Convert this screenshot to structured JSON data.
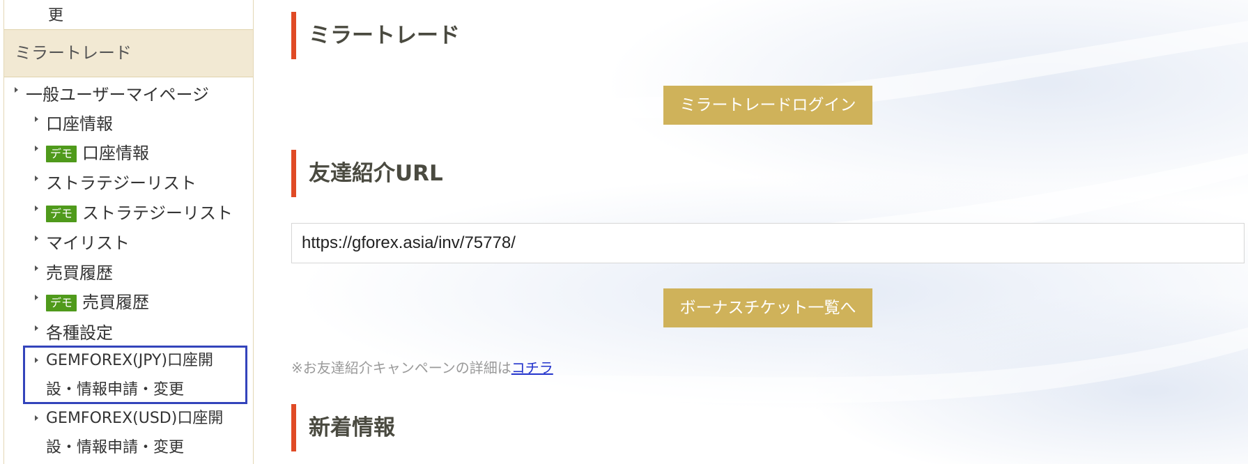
{
  "sidebar": {
    "prev_item_fragment": "更",
    "section_header": "ミラートレード",
    "items": [
      {
        "label": "一般ユーザーマイページ",
        "demo": false
      },
      {
        "label": "口座情報",
        "demo": false
      },
      {
        "label": "口座情報",
        "demo": true
      },
      {
        "label": "ストラテジーリスト",
        "demo": false
      },
      {
        "label": "ストラテジーリスト",
        "demo": true
      },
      {
        "label": "マイリスト",
        "demo": false
      },
      {
        "label": "売買履歴",
        "demo": false
      },
      {
        "label": "売買履歴",
        "demo": true
      },
      {
        "label": "各種設定",
        "demo": false
      },
      {
        "label_line1": "GEMFOREX(JPY)口座開",
        "label_line2": "設・情報申請・変更",
        "highlighted": true
      },
      {
        "label_line1": "GEMFOREX(USD)口座開",
        "label_line2": "設・情報申請・変更"
      }
    ],
    "demo_badge": "デモ"
  },
  "main": {
    "mirror_trade": {
      "title": "ミラートレード",
      "login_button": "ミラートレードログイン"
    },
    "referral": {
      "title": "友達紹介URL",
      "url_value": "https://gforex.asia/inv/75778/",
      "bonus_button": "ボーナスチケット一覧へ",
      "note_text": "※お友達紹介キャンペーンの詳細は",
      "note_link": "コチラ"
    },
    "news": {
      "title": "新着情報"
    }
  },
  "colors": {
    "accent_bar": "#e04a25",
    "gold_button": "#cfb25a",
    "demo_badge": "#4f9a1b",
    "sidebar_header_bg": "#f2e9d3",
    "highlight_box": "#3344bb",
    "link": "#2233cc"
  },
  "icons": {
    "list_bullet": "triangle-right-icon"
  }
}
